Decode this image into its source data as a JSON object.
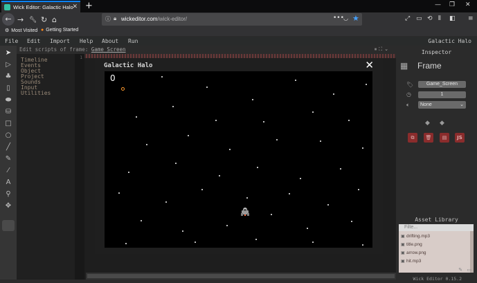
{
  "browser": {
    "tab_title": "Wick Editor: Galactic Halo",
    "tab_close": "✕",
    "new_tab": "+",
    "url_host": "wickeditor.com",
    "url_path": "/wick-editor/",
    "url_more": "•••",
    "bookmarks": [
      {
        "label": "Most Visited"
      },
      {
        "label": "Getting Started"
      }
    ],
    "accent_color": "#0a84ff"
  },
  "menu": {
    "items": [
      "File",
      "Edit",
      "Import",
      "Help",
      "About",
      "Run"
    ],
    "project_name": "Galactic Halo"
  },
  "scripts": {
    "header_prefix": "Edit scripts of frame:",
    "frame_name": "Game_Screen",
    "events": [
      "Timeline",
      "Events",
      "Object",
      "Project",
      "Sounds",
      "Input",
      "Utilities"
    ],
    "line_number": "1"
  },
  "preview": {
    "title": "Galactic Halo",
    "close": "✕",
    "score": "0"
  },
  "inspector": {
    "title": "Inspector",
    "object_type": "Frame",
    "name_value": "Game_Screen",
    "frame_length": "1",
    "sound_value": "None",
    "buttons": [
      "copy",
      "delete",
      "edit",
      "JS"
    ],
    "js_label": "JS"
  },
  "assets": {
    "title": "Asset Library",
    "filter_placeholder": "Filte...",
    "items": [
      {
        "name": "drifting.mp3",
        "icon": "sound-icon"
      },
      {
        "name": "title.png",
        "icon": "image-icon"
      },
      {
        "name": "arrow.png",
        "icon": "image-icon"
      },
      {
        "name": "hit.mp3",
        "icon": "sound-icon"
      }
    ]
  },
  "footer": {
    "version": "Wick Editor 0.15.2"
  }
}
